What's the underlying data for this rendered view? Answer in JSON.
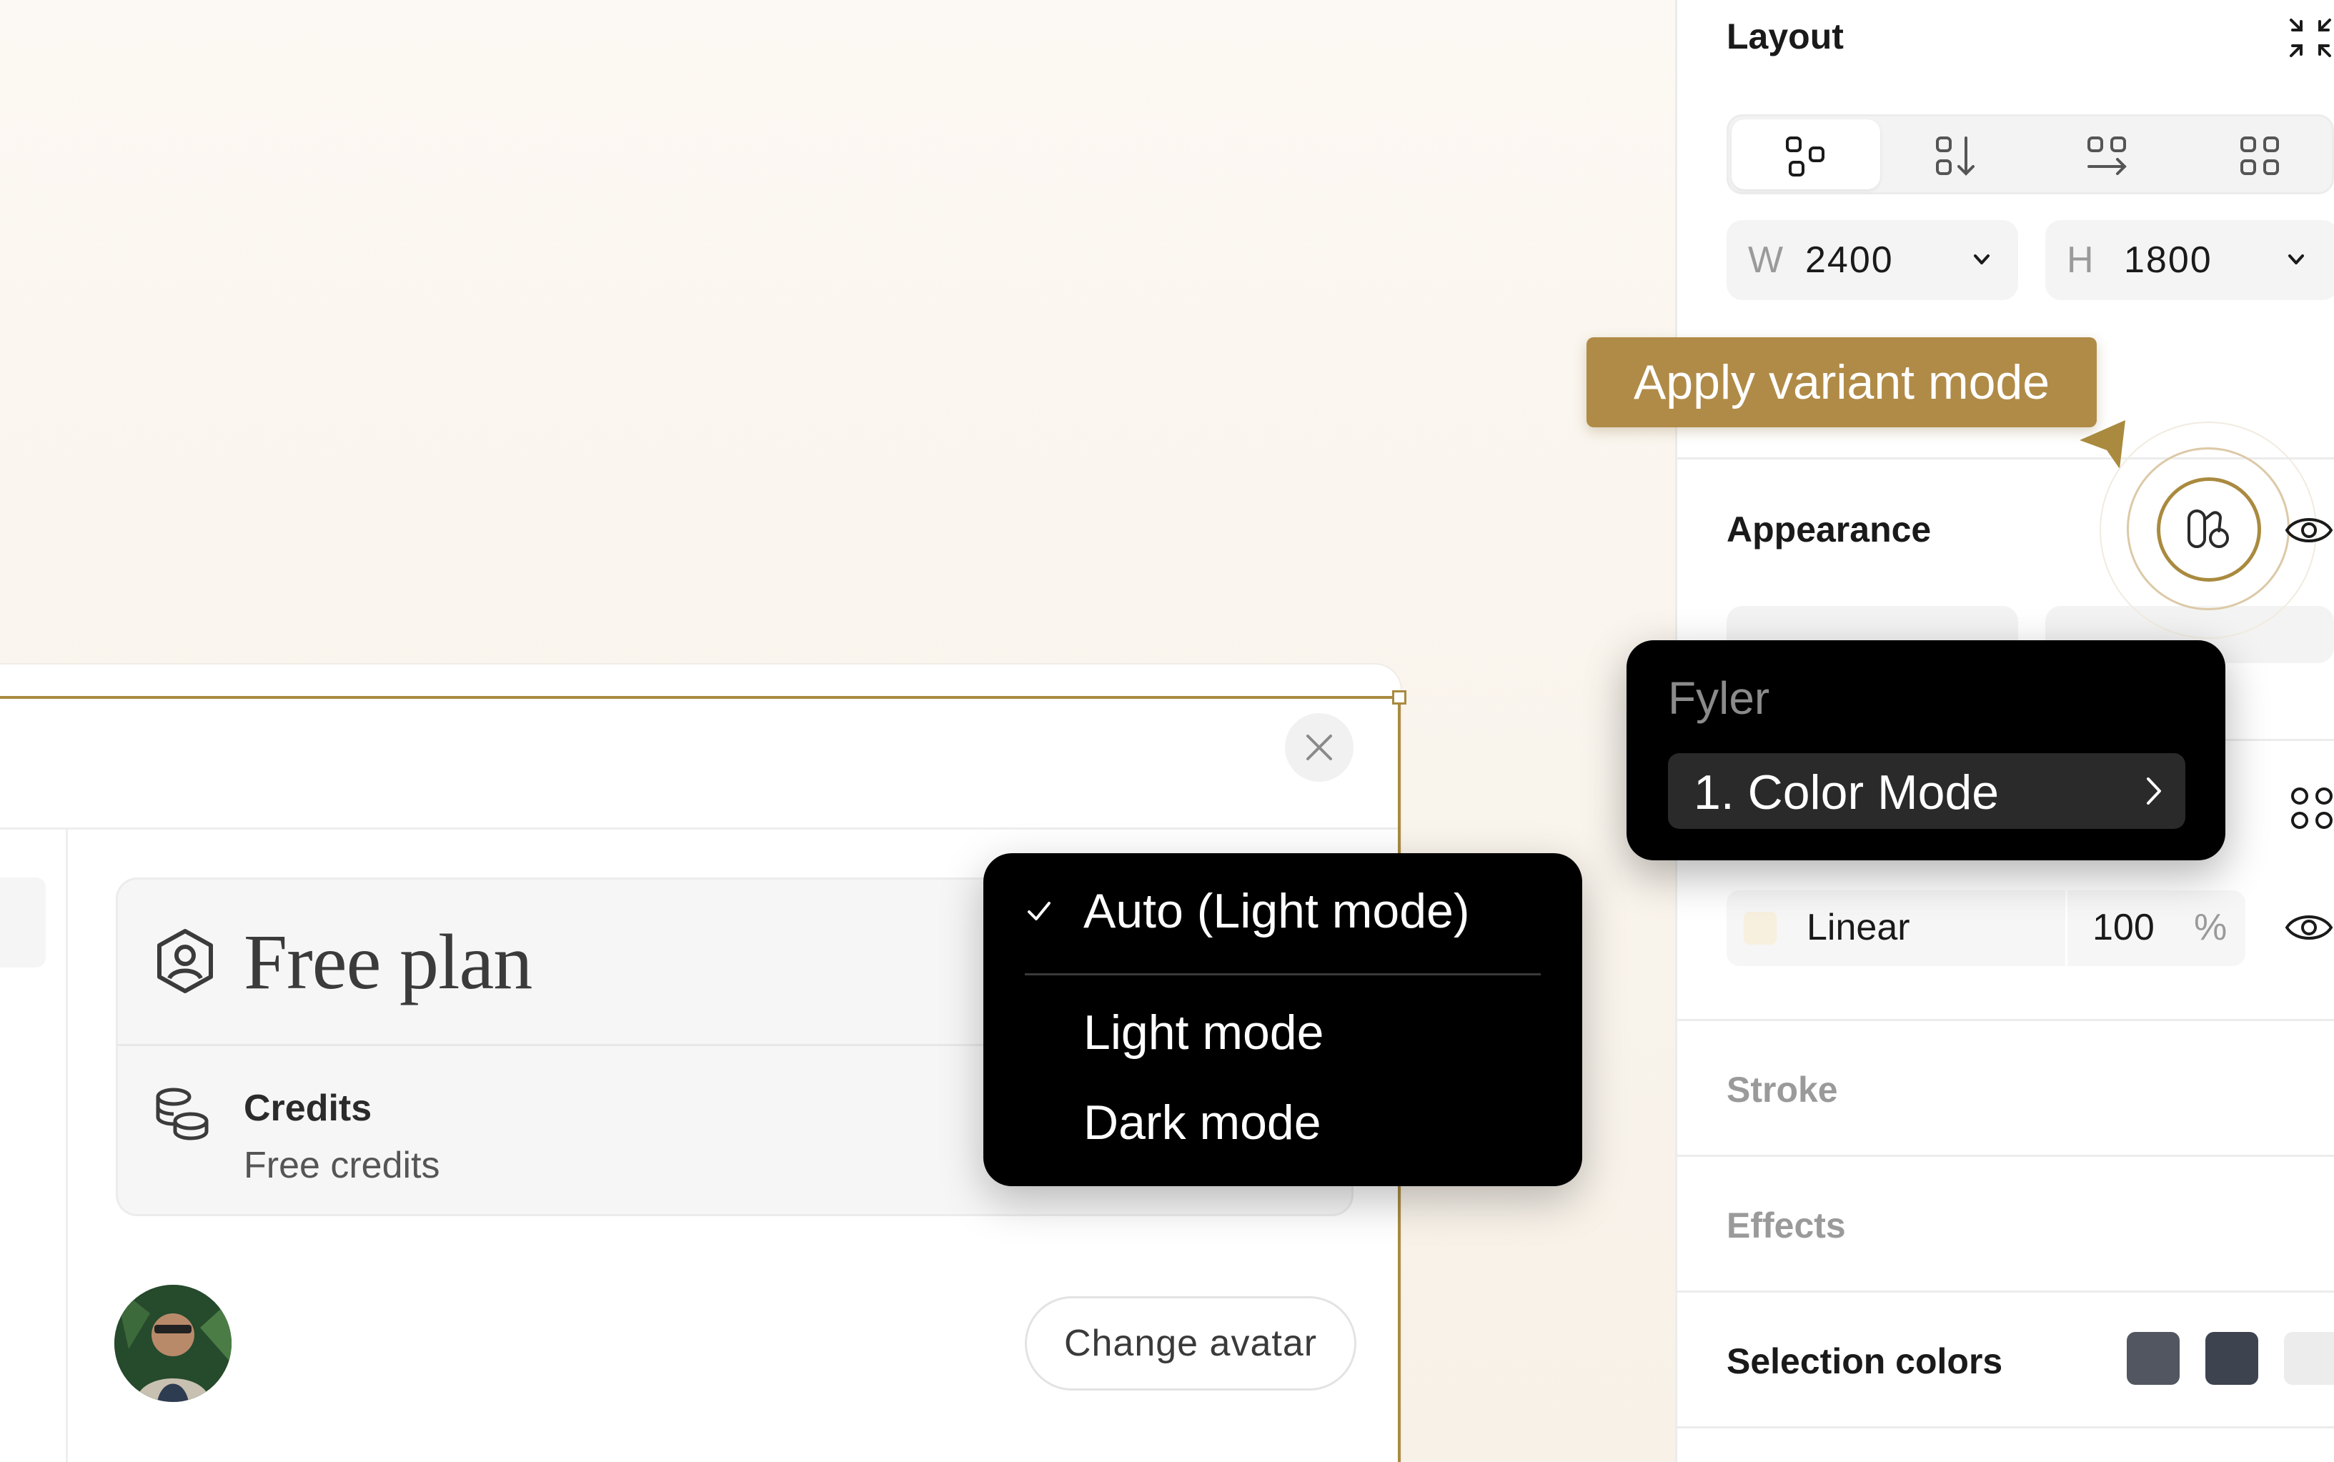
{
  "dialog": {
    "plan_title": "Free plan",
    "credits_label": "Credits",
    "credits_value": "Free credits",
    "change_avatar_label": "Change avatar"
  },
  "color_mode_menu": {
    "items": [
      {
        "label": "Auto (Light mode)",
        "checked": true
      },
      {
        "label": "Light mode",
        "checked": false
      },
      {
        "label": "Dark mode",
        "checked": false
      }
    ]
  },
  "panel": {
    "layout": {
      "title": "Layout",
      "modes": [
        "freeform-icon",
        "vertical-stack-icon",
        "horizontal-stack-icon",
        "grid-icon"
      ],
      "active_mode": "freeform-icon",
      "width_letter": "W",
      "width_value": "2400",
      "height_letter": "H",
      "height_value": "1800"
    },
    "tooltip": "Apply variant mode",
    "appearance": {
      "title": "Appearance"
    },
    "fyler_menu": {
      "title": "Fyler",
      "item_label": "1. Color Mode"
    },
    "fill": {
      "type": "Linear",
      "opacity": "100",
      "unit": "%",
      "swatch_color": "#f8f0de"
    },
    "stroke_title": "Stroke",
    "effects_title": "Effects",
    "selection_colors": {
      "title": "Selection colors",
      "colors": [
        "#525660",
        "#3e4350",
        "#ececec"
      ]
    }
  },
  "colors": {
    "accent": "#a98a3f",
    "tooltip_bg": "#b08b47",
    "menu_bg": "#000000"
  }
}
